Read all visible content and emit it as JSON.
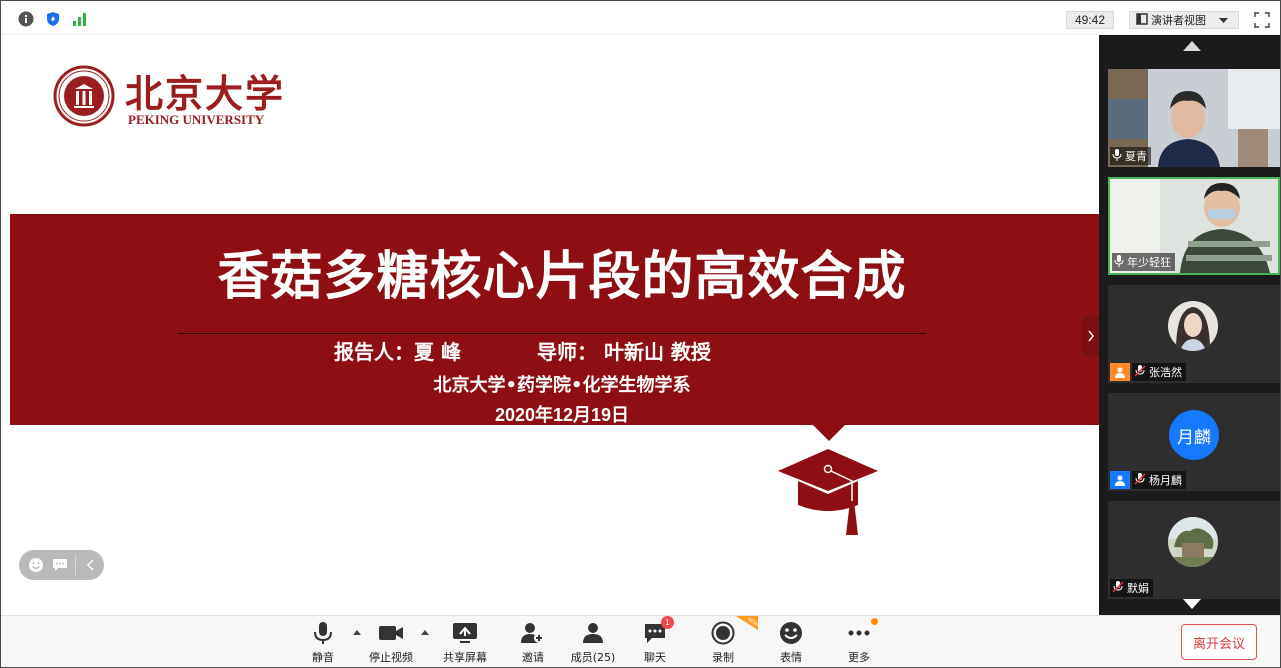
{
  "topbar": {
    "timer": "49:42",
    "view_label": "演讲者视图"
  },
  "slide": {
    "logo_title": "北京大学",
    "logo_sub": "PEKING UNIVERSITY",
    "title": "香菇多糖核心片段的高效合成",
    "reporter": "报告人：夏  峰",
    "advisor": "导师：  叶新山  教授",
    "department": "北京大学•药学院•化学生物学系",
    "date": "2020年12月19日"
  },
  "participants": [
    {
      "name": "夏青"
    },
    {
      "name": "年少轻狂"
    },
    {
      "name": "张浩然"
    },
    {
      "name": "杨月麟",
      "avatar_text": "月麟"
    },
    {
      "name": "默娟"
    }
  ],
  "toolbar": {
    "mute": "静音",
    "stop_video": "停止视频",
    "share_screen": "共享屏幕",
    "invite": "邀请",
    "members": "成员(25)",
    "chat": "聊天",
    "chat_badge": "1",
    "record": "录制",
    "new_tag": "NEW",
    "reactions": "表情",
    "more": "更多",
    "leave": "离开会议"
  },
  "colors": {
    "brand_red": "#8d0f14",
    "active_border": "#4bb35a",
    "leave_red": "#e03c3c"
  }
}
